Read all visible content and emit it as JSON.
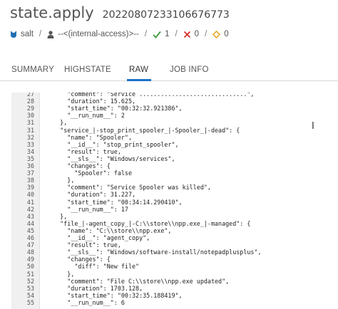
{
  "header": {
    "title": "state.apply",
    "job_id": "20220807233106676773"
  },
  "meta": {
    "target": "salt",
    "user": "--<(internal-access)>--",
    "success_count": "1",
    "fail_count": "0",
    "warning_count": "0"
  },
  "colors": {
    "accent": "#1a73c7",
    "salt_icon": "#1f6fb2",
    "success": "#3c9a3c",
    "fail": "#d9302c",
    "warning": "#e8a319"
  },
  "tabs": [
    {
      "label": "SUMMARY",
      "active": false
    },
    {
      "label": "HIGHSTATE",
      "active": false
    },
    {
      "label": "RAW",
      "active": true
    },
    {
      "label": "JOB INFO",
      "active": false
    }
  ],
  "code_lines": [
    {
      "n": "27",
      "t": "      \"comment\": \"Service ..............................\","
    },
    {
      "n": "28",
      "t": "      \"duration\": 15.625,"
    },
    {
      "n": "29",
      "t": "      \"start_time\": \"00:32:32.921386\","
    },
    {
      "n": "30",
      "t": "      \"__run_num__\": 2"
    },
    {
      "n": "31",
      "t": "    },"
    },
    {
      "n": "31",
      "t": "    \"service_|-stop_print_spooler_|-Spooler_|-dead\": {"
    },
    {
      "n": "32",
      "t": "      \"name\": \"Spooler\","
    },
    {
      "n": "33",
      "t": "      \"__id__\": \"stop_print_spooler\","
    },
    {
      "n": "34",
      "t": "      \"result\": true,"
    },
    {
      "n": "35",
      "t": "      \"__sls__\": \"Windows/services\","
    },
    {
      "n": "36",
      "t": "      \"changes\": {"
    },
    {
      "n": "37",
      "t": "        \"Spooler\": false"
    },
    {
      "n": "38",
      "t": "      },"
    },
    {
      "n": "39",
      "t": "      \"comment\": \"Service Spooler was killed\","
    },
    {
      "n": "40",
      "t": "      \"duration\": 31.227,"
    },
    {
      "n": "41",
      "t": "      \"start_time\": \"00:34:14.290410\","
    },
    {
      "n": "42",
      "t": "      \"__run_num__\": 17"
    },
    {
      "n": "43",
      "t": "    },"
    },
    {
      "n": "44",
      "t": "    \"file_|-agent_copy_|-C:\\\\store\\\\npp.exe_|-managed\": {"
    },
    {
      "n": "45",
      "t": "      \"name\": \"C:\\\\store\\\\npp.exe\","
    },
    {
      "n": "46",
      "t": "      \"__id__\": \"agent_copy\","
    },
    {
      "n": "47",
      "t": "      \"result\": true,"
    },
    {
      "n": "48",
      "t": "      \"__sls__\": \"Windows/software-install/notepadplusplus\","
    },
    {
      "n": "49",
      "t": "      \"changes\": {"
    },
    {
      "n": "50",
      "t": "        \"diff\": \"New file\""
    },
    {
      "n": "51",
      "t": "      },"
    },
    {
      "n": "52",
      "t": "      \"comment\": \"File C:\\\\store\\\\npp.exe updated\","
    },
    {
      "n": "53",
      "t": "      \"duration\": 1703.128,"
    },
    {
      "n": "54",
      "t": "      \"start_time\": \"00:32:35.188419\","
    },
    {
      "n": "55",
      "t": "      \"__run_num__\": 6"
    }
  ]
}
